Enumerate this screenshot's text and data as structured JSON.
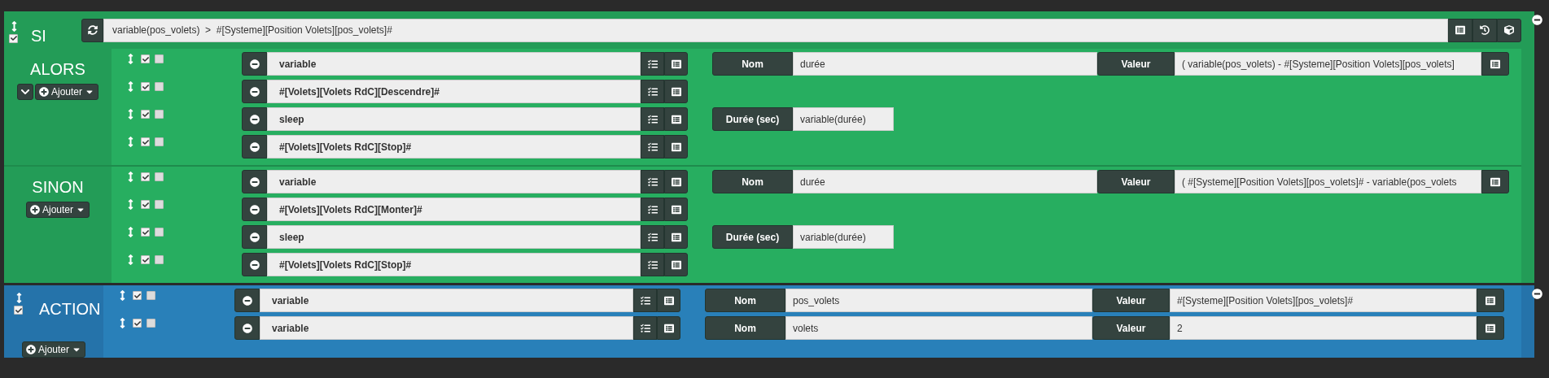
{
  "blocks": [
    {
      "kind": "if",
      "title": "SI",
      "checked": true,
      "expression": "variable(pos_volets)  >  #[Systeme][Position Volets][pos_volets]#",
      "sections": [
        {
          "title": "ALORS",
          "collapse_button": true,
          "add_label": "Ajouter",
          "actions": [
            {
              "active": true,
              "parallel": false,
              "command": "variable",
              "params": [
                {
                  "kind": "wide",
                  "label": "Nom",
                  "value": "durée"
                },
                {
                  "kind": "wide",
                  "label": "Valeur",
                  "value": "( variable(pos_volets) - #[Systeme][Position Volets][pos_volets]",
                  "button": true
                }
              ]
            },
            {
              "active": true,
              "parallel": false,
              "command": "#[Volets][Volets RdC][Descendre]#"
            },
            {
              "active": true,
              "parallel": false,
              "command": "sleep",
              "params": [
                {
                  "kind": "short",
                  "label": "Durée (sec)",
                  "value": "variable(durée)"
                }
              ]
            },
            {
              "active": true,
              "parallel": false,
              "command": "#[Volets][Volets RdC][Stop]#"
            }
          ]
        },
        {
          "title": "SINON",
          "collapse_button": false,
          "add_label": "Ajouter",
          "actions": [
            {
              "active": true,
              "parallel": false,
              "command": "variable",
              "params": [
                {
                  "kind": "wide",
                  "label": "Nom",
                  "value": "durée"
                },
                {
                  "kind": "wide",
                  "label": "Valeur",
                  "value": "( #[Systeme][Position Volets][pos_volets]# - variable(pos_volets",
                  "button": true
                }
              ]
            },
            {
              "active": true,
              "parallel": false,
              "command": "#[Volets][Volets RdC][Monter]#"
            },
            {
              "active": true,
              "parallel": false,
              "command": "sleep",
              "params": [
                {
                  "kind": "short",
                  "label": "Durée (sec)",
                  "value": "variable(durée)"
                }
              ]
            },
            {
              "active": true,
              "parallel": false,
              "command": "#[Volets][Volets RdC][Stop]#"
            }
          ]
        }
      ]
    },
    {
      "kind": "action",
      "title": "ACTION",
      "checked": true,
      "sections": [
        {
          "add_label": "Ajouter",
          "actions": [
            {
              "active": true,
              "parallel": false,
              "command": "variable",
              "params": [
                {
                  "kind": "wide",
                  "label": "Nom",
                  "value": "pos_volets"
                },
                {
                  "kind": "wide",
                  "label": "Valeur",
                  "value": "#[Systeme][Position Volets][pos_volets]#",
                  "button": true
                }
              ]
            },
            {
              "active": true,
              "parallel": false,
              "command": "variable",
              "params": [
                {
                  "kind": "wide",
                  "label": "Nom",
                  "value": "volets"
                },
                {
                  "kind": "wide",
                  "label": "Valeur",
                  "value": "2",
                  "button": true
                }
              ]
            }
          ]
        }
      ]
    }
  ]
}
